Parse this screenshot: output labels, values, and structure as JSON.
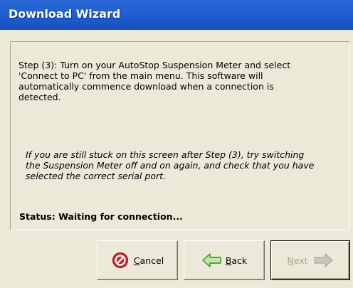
{
  "window": {
    "title": "Download Wizard"
  },
  "content": {
    "step_text": "Step (3): Turn on your AutoStop Suspension Meter and select\n'Connect to PC' from the main menu.  This software will\nautomatically commence download when a connection is\ndetected.",
    "hint_text": "If you are still stuck on this screen after Step (3), try switching\nthe Suspension Meter off and on again, and check that you have\nselected the correct serial port.",
    "status_text": "Status: Waiting for connection..."
  },
  "buttons": {
    "cancel": {
      "label_first": "C",
      "label_rest": "ancel",
      "icon": "cancel-icon",
      "enabled": true
    },
    "back": {
      "label_first": "B",
      "label_rest": "ack",
      "icon": "left-arrow-icon",
      "enabled": true
    },
    "next": {
      "label_first": "N",
      "label_rest": "ext",
      "icon": "right-arrow-icon",
      "enabled": false
    }
  },
  "colors": {
    "titlebar": "#2060d0",
    "dialog_bg": "#ece9d8",
    "cancel_red": "#d82020",
    "back_green": "#4caf2a",
    "disabled_gray": "#aca899"
  }
}
